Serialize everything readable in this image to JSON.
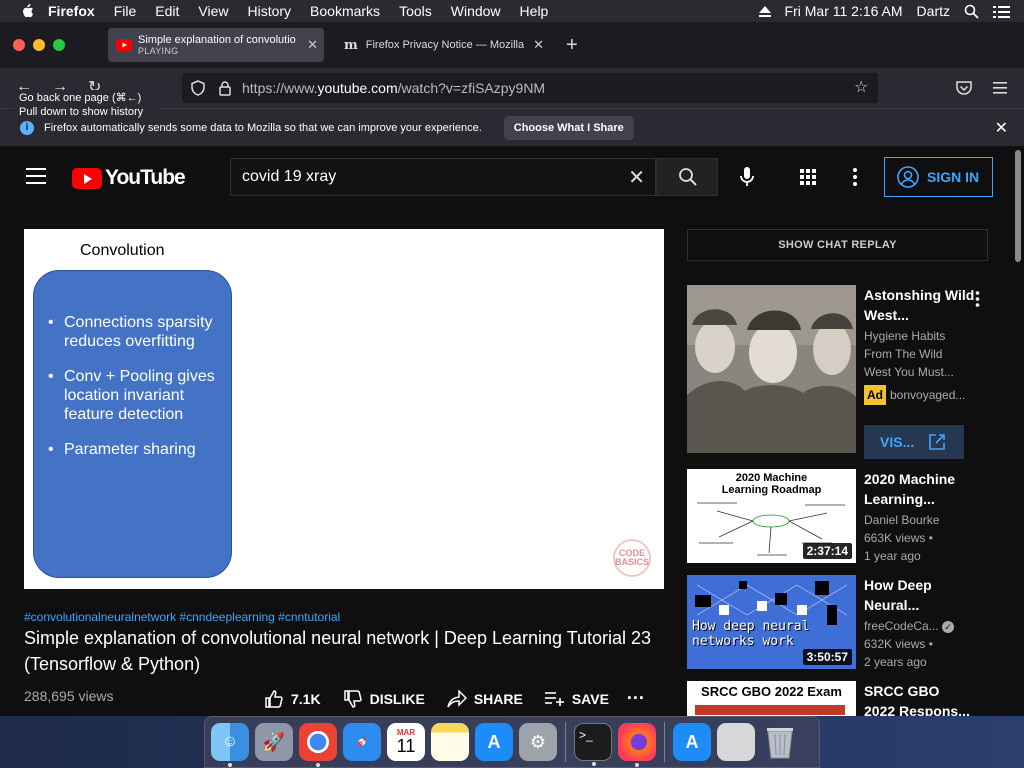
{
  "menubar": {
    "app_name": "Firefox",
    "items": [
      "File",
      "Edit",
      "View",
      "History",
      "Bookmarks",
      "Tools",
      "Window",
      "Help"
    ],
    "datetime": "Fri Mar 11  2:16 AM",
    "user": "Dartz"
  },
  "tabs": [
    {
      "title": "Simple explanation of convolutio",
      "status": "PLAYING",
      "icon": "youtube-icon"
    },
    {
      "title": "Firefox Privacy Notice — Mozilla",
      "icon": "mozilla-icon"
    }
  ],
  "toolbar": {
    "url_prefix": "https://www.",
    "url_domain": "youtube.com",
    "url_path": "/watch?v=zfiSAzpy9NM",
    "tooltip_line1": "Go back one page (⌘←)",
    "tooltip_line2": "Pull down to show history"
  },
  "notification": {
    "message": "Firefox automatically sends some data to Mozilla so that we can improve your experience.",
    "button": "Choose What I Share"
  },
  "youtube": {
    "logo_text": "YouTube",
    "search_value": "covid 19 xray",
    "sign_in": "SIGN IN",
    "brand_color": "#ff0000",
    "link_color": "#3ea6ff"
  },
  "video": {
    "slide_title": "Convolution",
    "bullets": [
      "Connections sparsity reduces overfitting",
      "Conv + Pooling gives location invariant feature detection",
      "Parameter sharing"
    ],
    "watermark": "CODE BASICS",
    "hashtags": "#convolutionalneuralnetwork #cnndeeplearning #cnntutorial",
    "title": "Simple explanation of convolutional neural network | Deep Learning Tutorial 23 (Tensorflow & Python)",
    "views": "288,695 views",
    "likes": "7.1K",
    "dislike": "DISLIKE",
    "share": "SHARE",
    "save": "SAVE"
  },
  "sidebar": {
    "chat_replay": "SHOW CHAT REPLAY",
    "ad": {
      "title": "Astonshing Wild West...",
      "desc1": "Hygiene Habits",
      "desc2": "From The Wild",
      "desc3": "West You Must...",
      "badge": "Ad",
      "advertiser": "bonvoyaged...",
      "cta": "VIS..."
    },
    "recs": [
      {
        "title1": "2020 Machine",
        "title2": "Learning...",
        "channel": "Daniel Bourke",
        "views": "663K views •",
        "age": "1 year ago",
        "duration": "2:37:14",
        "thumb_text": "2020 Machine Learning Roadmap"
      },
      {
        "title1": "How Deep",
        "title2": "Neural...",
        "channel": "freeCodeCa...",
        "views": "632K views •",
        "age": "2 years ago",
        "duration": "3:50:57",
        "thumb_text": "How deep neural networks work"
      },
      {
        "title1": "SRCC GBO",
        "title2": "2022 Respons...",
        "thumb_text": "SRCC GBO 2022 Exam"
      }
    ]
  },
  "dock": {
    "apps": [
      "finder-icon",
      "launchpad-icon",
      "chrome-icon",
      "safari-icon",
      "calendar-icon",
      "notes-icon",
      "app-store-icon",
      "system-preferences-icon",
      "terminal-icon",
      "firefox-icon",
      "app-store-icon",
      "files-icon",
      "trash-icon"
    ],
    "calendar_month": "MAR",
    "calendar_day": "11"
  }
}
